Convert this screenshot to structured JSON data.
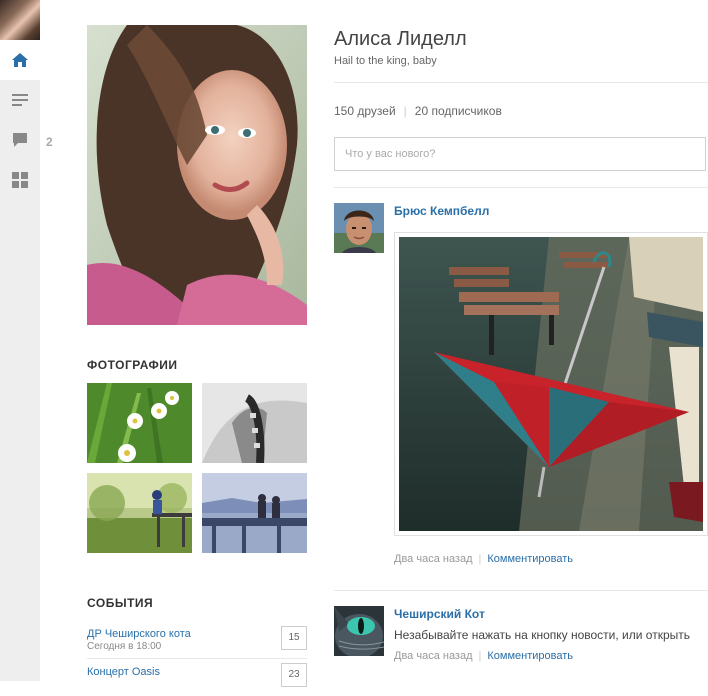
{
  "sidebar": {
    "badge_count": "2",
    "items": [
      {
        "name": "home-icon",
        "active": true
      },
      {
        "name": "feed-icon",
        "active": false
      },
      {
        "name": "messages-icon",
        "active": false
      },
      {
        "name": "apps-grid-icon",
        "active": false
      }
    ],
    "accent_color": "#2a6fa8"
  },
  "profile": {
    "name": "Алиса Лиделл",
    "status": "Hail to the king, baby",
    "friends": "150 друзей",
    "followers": "20 подписчиков"
  },
  "photos": {
    "title": "ФОТОГРАФИИ"
  },
  "events": {
    "title": "СОБЫТИЯ",
    "items": [
      {
        "name": "ДР Чеширского кота",
        "time": "Сегодня в 18:00",
        "day": "15"
      },
      {
        "name": "Концерт Oasis",
        "time": "",
        "day": "23"
      }
    ]
  },
  "composer": {
    "placeholder": "Что у вас нового?"
  },
  "posts": [
    {
      "author": "Брюс Кемпбелл",
      "time": "Два часа назад",
      "action": "Комментировать"
    },
    {
      "author": "Чеширский Кот",
      "text": "Незабывайте нажать на кнопку новости, или открыть",
      "time": "Два часа назад",
      "action": "Комментировать"
    }
  ]
}
